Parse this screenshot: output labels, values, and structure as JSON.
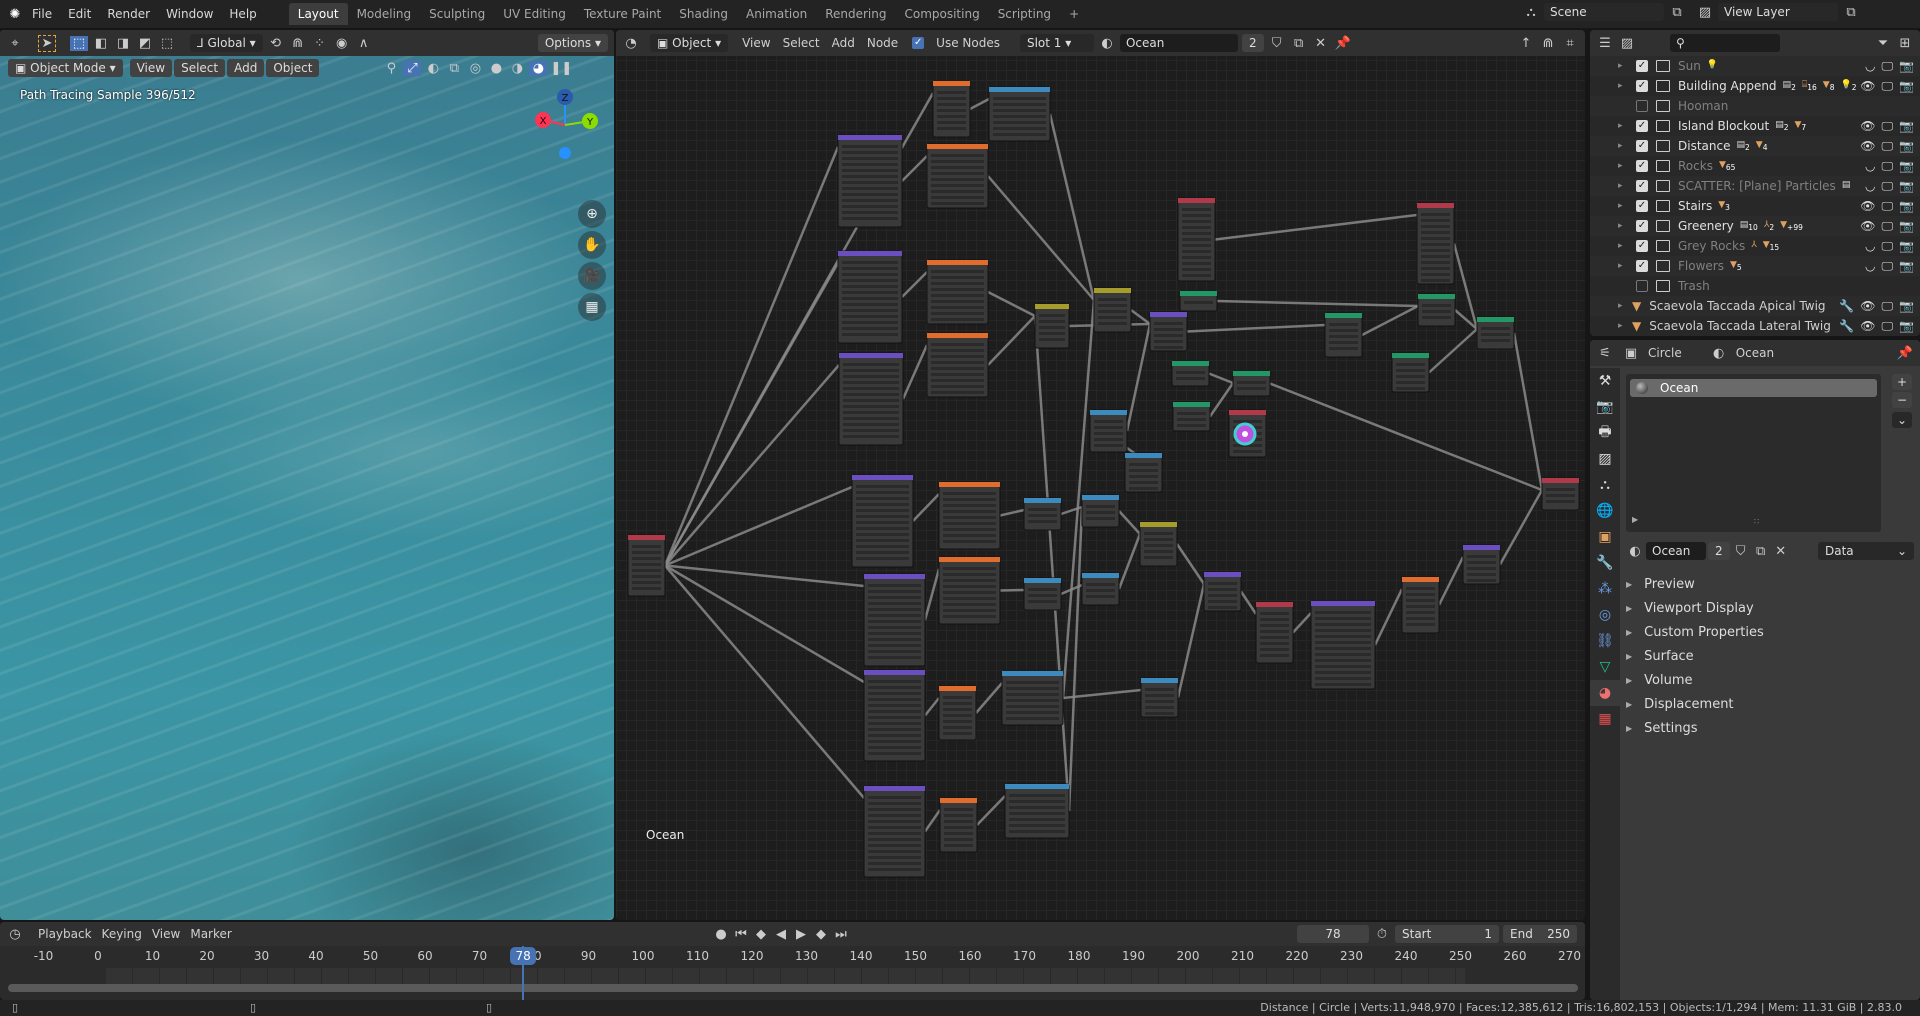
{
  "topbar": {
    "menus": [
      "File",
      "Edit",
      "Render",
      "Window",
      "Help"
    ],
    "workspaces": [
      "Layout",
      "Modeling",
      "Sculpting",
      "UV Editing",
      "Texture Paint",
      "Shading",
      "Animation",
      "Rendering",
      "Compositing",
      "Scripting"
    ],
    "active_workspace": "Layout",
    "add_workspace": "+",
    "scene": "Scene",
    "view_layer": "View Layer"
  },
  "viewport": {
    "transform_orientation": "Global",
    "options": "Options",
    "mode": "Object Mode",
    "menus": [
      "View",
      "Select",
      "Add",
      "Object"
    ],
    "overlay_text": "Path Tracing Sample 396/512",
    "gizmo_axes": {
      "x": "X",
      "y": "Y",
      "z": "Z"
    },
    "colors": {
      "x": "#ff3352",
      "y": "#8bdc00",
      "z": "#2890ff"
    }
  },
  "node_editor": {
    "type": "Object",
    "menus": [
      "View",
      "Select",
      "Add",
      "Node"
    ],
    "use_nodes_label": "Use Nodes",
    "use_nodes": true,
    "slot": "Slot 1",
    "material": "Ocean",
    "users": "2",
    "tree_label": "Ocean",
    "header_colors": {
      "input": "#83314a",
      "texture": "#e06c2e",
      "shader": "#3d8abe",
      "converter": "#6b4ec0",
      "color": "#a59c2c",
      "vector": "#239866",
      "output": "#b03a4a"
    }
  },
  "outliner": {
    "search_placeholder": "",
    "rows": [
      {
        "name": "Sun",
        "checked": true,
        "enabled": false,
        "badges": [
          {
            "icon": "light",
            "count": ""
          }
        ]
      },
      {
        "name": "Building Append",
        "checked": true,
        "enabled": true,
        "badges": [
          {
            "icon": "collection",
            "count": "2"
          },
          {
            "icon": "empty",
            "count": "16"
          },
          {
            "icon": "mesh",
            "count": "8"
          },
          {
            "icon": "light",
            "count": "2"
          }
        ]
      },
      {
        "name": "Hooman",
        "checked": false,
        "enabled": false,
        "badges": []
      },
      {
        "name": "Island Blockout",
        "checked": true,
        "enabled": true,
        "badges": [
          {
            "icon": "collection",
            "count": "2"
          },
          {
            "icon": "mesh",
            "count": "7"
          }
        ]
      },
      {
        "name": "Distance",
        "checked": true,
        "enabled": true,
        "badges": [
          {
            "icon": "collection",
            "count": "2"
          },
          {
            "icon": "mesh",
            "count": "4"
          }
        ]
      },
      {
        "name": "Rocks",
        "checked": true,
        "enabled": false,
        "badges": [
          {
            "icon": "mesh",
            "count": "65"
          }
        ]
      },
      {
        "name": "SCATTER: [Plane] Particles",
        "checked": true,
        "enabled": false,
        "badges": [
          {
            "icon": "collection",
            "count": ""
          }
        ]
      },
      {
        "name": "Stairs",
        "checked": true,
        "enabled": true,
        "badges": [
          {
            "icon": "mesh",
            "count": "3"
          }
        ]
      },
      {
        "name": "Greenery",
        "checked": true,
        "enabled": true,
        "badges": [
          {
            "icon": "collection",
            "count": "10"
          },
          {
            "icon": "armature",
            "count": "2"
          },
          {
            "icon": "mesh",
            "count": "+99"
          }
        ]
      },
      {
        "name": "Grey Rocks",
        "checked": true,
        "enabled": false,
        "badges": [
          {
            "icon": "armature",
            "count": ""
          },
          {
            "icon": "mesh",
            "count": "15"
          }
        ]
      },
      {
        "name": "Flowers",
        "checked": true,
        "enabled": false,
        "badges": [
          {
            "icon": "mesh",
            "count": "5"
          }
        ]
      },
      {
        "name": "Trash",
        "checked": false,
        "enabled": false,
        "badges": []
      }
    ],
    "objects": [
      {
        "name": "Scaevola Taccada Apical Twig"
      },
      {
        "name": "Scaevola Taccada Lateral Twig"
      }
    ]
  },
  "properties": {
    "breadcrumb_object": "Circle",
    "breadcrumb_material": "Ocean",
    "slot_item": "Ocean",
    "material_name": "Ocean",
    "users": "2",
    "link": "Data",
    "panels": [
      "Preview",
      "Viewport Display",
      "Custom Properties",
      "Surface",
      "Volume",
      "Displacement",
      "Settings"
    ],
    "tabs": [
      "tool-icon",
      "render-icon",
      "output-icon",
      "view-layer-icon",
      "scene-icon",
      "world-icon",
      "object-icon",
      "modifier-icon",
      "particles-icon",
      "physics-icon",
      "constraints-icon",
      "data-icon",
      "material-icon",
      "texture-icon"
    ],
    "active_tab": "material-icon"
  },
  "timeline": {
    "menus": [
      "Playback",
      "Keying",
      "View",
      "Marker"
    ],
    "current_frame": "78",
    "start_label": "Start",
    "start": "1",
    "end_label": "End",
    "end": "250",
    "ticks": [
      "-10",
      "0",
      "10",
      "20",
      "30",
      "40",
      "50",
      "60",
      "70",
      "80",
      "90",
      "100",
      "110",
      "120",
      "130",
      "140",
      "150",
      "160",
      "170",
      "180",
      "190",
      "200",
      "210",
      "220",
      "230",
      "240",
      "250",
      "260",
      "270"
    ]
  },
  "status": {
    "text": "Distance | Circle | Verts:11,948,970 | Faces:12,385,612 | Tris:16,802,153 | Objects:1/1,294 | Mem: 11.31 GiB | 2.83.0"
  }
}
